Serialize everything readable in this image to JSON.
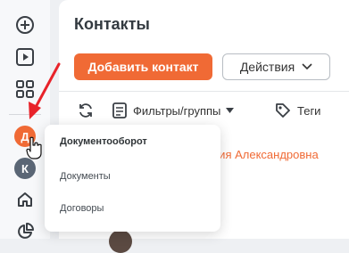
{
  "sidebar": {
    "items": [
      {
        "icon": "plus-circle-icon"
      },
      {
        "icon": "play-icon"
      },
      {
        "icon": "grid-icon"
      }
    ],
    "active_avatar": {
      "letter": "Д",
      "color": "#f06a35"
    },
    "avatar_k": {
      "letter": "К",
      "color": "#5a6675"
    },
    "bottom_items": [
      {
        "icon": "home-icon"
      },
      {
        "icon": "pie-chart-icon"
      }
    ]
  },
  "header": {
    "title": "Контакты"
  },
  "toolbar": {
    "add_contact_label": "Добавить контакт",
    "actions_label": "Действия",
    "filters_label": "Фильтры/группы",
    "tags_label": "Теги"
  },
  "contacts": {
    "visible_name": "ния Александровна"
  },
  "dropdown": {
    "heading": "Документооборот",
    "items": [
      "Документы",
      "Договоры"
    ]
  },
  "colors": {
    "accent": "#f06a35",
    "annotation_arrow": "#e8232a"
  }
}
